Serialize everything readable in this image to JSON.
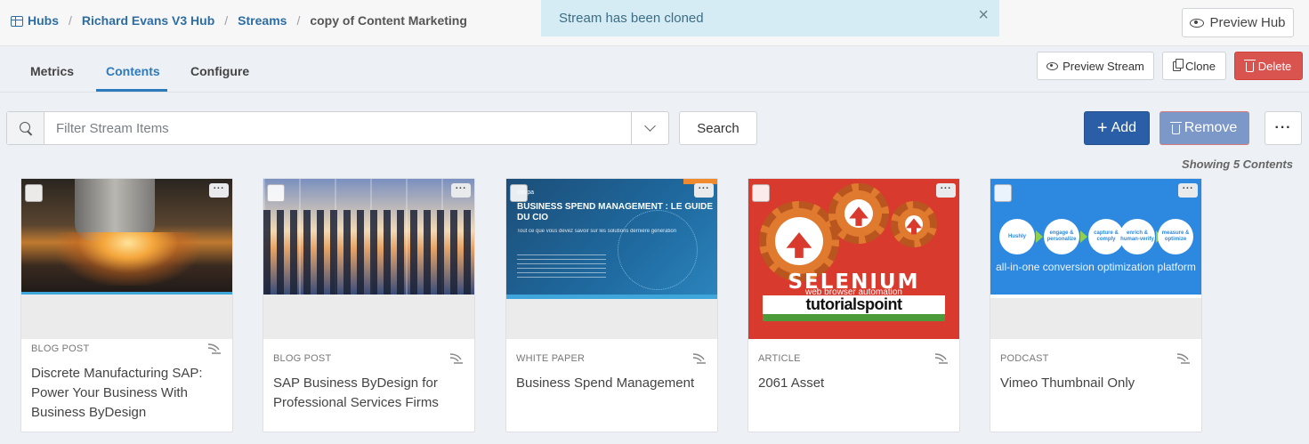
{
  "breadcrumb": {
    "hubs": "Hubs",
    "hub_name": "Richard Evans V3 Hub",
    "streams": "Streams",
    "current": "copy of Content Marketing",
    "separator": "/"
  },
  "toast": {
    "message": "Stream has been cloned",
    "close": "×"
  },
  "header": {
    "preview_hub": "Preview Hub"
  },
  "tabs": [
    {
      "label": "Metrics",
      "active": false
    },
    {
      "label": "Contents",
      "active": true
    },
    {
      "label": "Configure",
      "active": false
    }
  ],
  "stream_actions": {
    "preview_stream": "Preview Stream",
    "clone": "Clone",
    "delete": "Delete"
  },
  "filter": {
    "placeholder": "Filter Stream Items",
    "value": "",
    "search_label": "Search"
  },
  "list_actions": {
    "add": "Add",
    "remove": "Remove",
    "more": "···"
  },
  "showing": "Showing 5 Contents",
  "cards": [
    {
      "type": "BLOG POST",
      "title": "Discrete Manufacturing SAP: Power Your Business With Business ByDesign",
      "thumb": "laser-cutting"
    },
    {
      "type": "BLOG POST",
      "title": "SAP Business ByDesign for Professional Services Firms",
      "thumb": "business-silhouettes"
    },
    {
      "type": "WHITE PAPER",
      "title": "Business Spend Management",
      "thumb": "coupa-cover",
      "thumb_text": {
        "brand": "coupa",
        "heading": "BUSINESS SPEND MANAGEMENT : LE GUIDE DU CIO",
        "sub": "Tout ce que vous devez savoir sur les solutions dernière génération"
      }
    },
    {
      "type": "ARTICLE",
      "title": "2061 Asset",
      "thumb": "selenium-logo",
      "thumb_text": {
        "name": "SELENIUM",
        "tagline": "web browser automation",
        "brand": "tutorialspoint"
      }
    },
    {
      "type": "PODCAST",
      "title": "Vimeo Thumbnail Only",
      "thumb": "hushly-banner",
      "thumb_text": {
        "logo": "Hushly",
        "steps": [
          "engage & personalize",
          "capture & comply",
          "enrich & human-verify",
          "measure & optimize"
        ],
        "caption": "all-in-one conversion optimization platform"
      }
    }
  ],
  "card_more": "···",
  "colors": {
    "primary": "#2a5fa8",
    "danger": "#d9534f",
    "accent": "#2d7bbd",
    "toast_bg": "#d6ecf4"
  }
}
